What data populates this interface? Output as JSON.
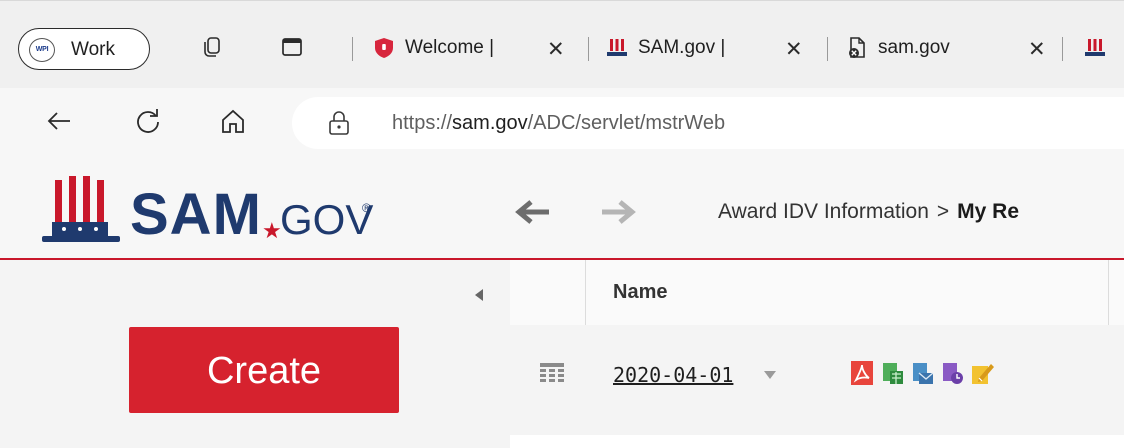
{
  "browser": {
    "profile_label": "Work",
    "profile_badge": "WPI",
    "tabs": [
      {
        "title": "Welcome |",
        "icon": "shield-icon",
        "close": "✕"
      },
      {
        "title": "SAM.gov |",
        "icon": "sam-hat-icon",
        "close": "✕"
      },
      {
        "title": "sam.gov",
        "icon": "blocked-page-icon",
        "close": "✕"
      }
    ],
    "url_prefix": "https://",
    "url_host": "sam.gov",
    "url_path": "/ADC/servlet/mstrWeb"
  },
  "site": {
    "logo_text": "SAM.GOV",
    "breadcrumb": {
      "item": "Award IDV Information",
      "separator": ">",
      "current": "My Re"
    }
  },
  "sidebar": {
    "create_label": "Create"
  },
  "grid": {
    "column_name": "Name",
    "row": {
      "date": "2020-04-01"
    }
  },
  "colors": {
    "accent": "#d6222e",
    "brand_navy": "#1f3a6e",
    "brand_red": "#c9182b"
  }
}
